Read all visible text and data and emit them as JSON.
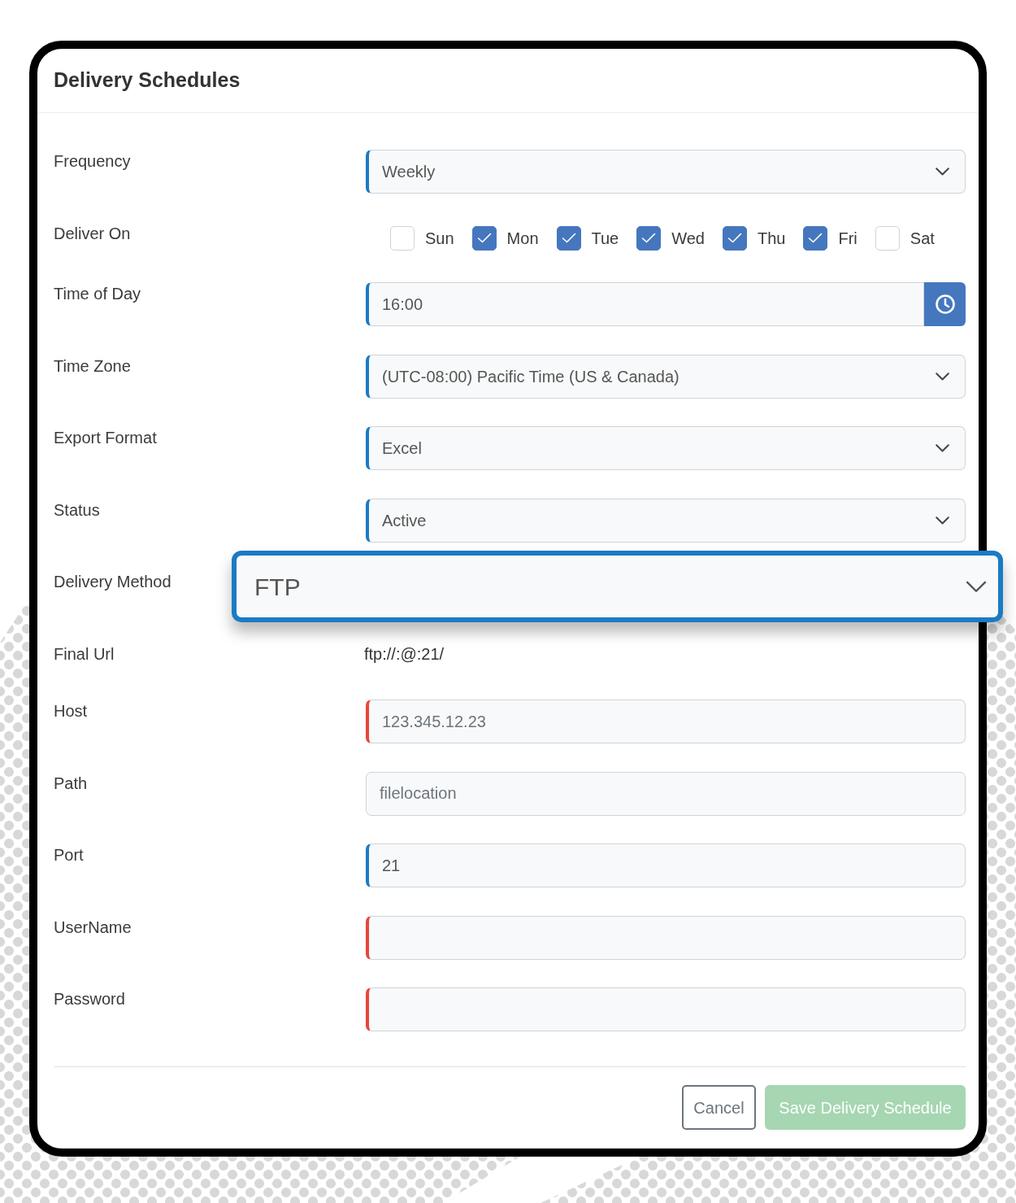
{
  "dialog": {
    "title": "Delivery Schedules"
  },
  "fields": [
    {
      "kind": "select",
      "label": "Frequency",
      "value": "Weekly",
      "required": true,
      "highlighted": false
    },
    {
      "kind": "checkboxes",
      "label": "Deliver On",
      "highlighted": false,
      "options": [
        {
          "label": "Sun",
          "checked": false
        },
        {
          "label": "Mon",
          "checked": true
        },
        {
          "label": "Tue",
          "checked": true
        },
        {
          "label": "Wed",
          "checked": true
        },
        {
          "label": "Thu",
          "checked": true
        },
        {
          "label": "Fri",
          "checked": true
        },
        {
          "label": "Sat",
          "checked": false
        }
      ]
    },
    {
      "kind": "time",
      "label": "Time of Day",
      "value": "16:00",
      "required": true,
      "highlighted": false
    },
    {
      "kind": "select",
      "label": "Time Zone",
      "value": "(UTC-08:00) Pacific Time (US & Canada)",
      "required": true,
      "highlighted": false
    },
    {
      "kind": "select",
      "label": "Export Format",
      "value": "Excel",
      "required": true,
      "highlighted": false
    },
    {
      "kind": "select",
      "label": "Status",
      "value": "Active",
      "required": true,
      "highlighted": false
    },
    {
      "kind": "select",
      "label": "Delivery Method",
      "value": "FTP",
      "highlighted": true
    },
    {
      "kind": "text",
      "label": "Final Url",
      "value": "ftp://:@:21/",
      "highlighted": false
    },
    {
      "kind": "input",
      "label": "Host",
      "placeholder": "123.345.12.23",
      "required": true,
      "highlighted": false
    },
    {
      "kind": "input",
      "label": "Path",
      "placeholder": "filelocation",
      "required": false,
      "highlighted": false
    },
    {
      "kind": "input",
      "label": "Port",
      "value": "21",
      "required": true,
      "highlighted": false
    },
    {
      "kind": "input",
      "label": "UserName",
      "required": true,
      "highlighted": false
    },
    {
      "kind": "input",
      "label": "Password",
      "required": true,
      "highlighted": false
    }
  ],
  "buttons": [
    {
      "kind": "secondary",
      "label": "Cancel",
      "disabled": false
    },
    {
      "kind": "primary",
      "label": "Save Delivery Schedule",
      "disabled": true
    }
  ]
}
